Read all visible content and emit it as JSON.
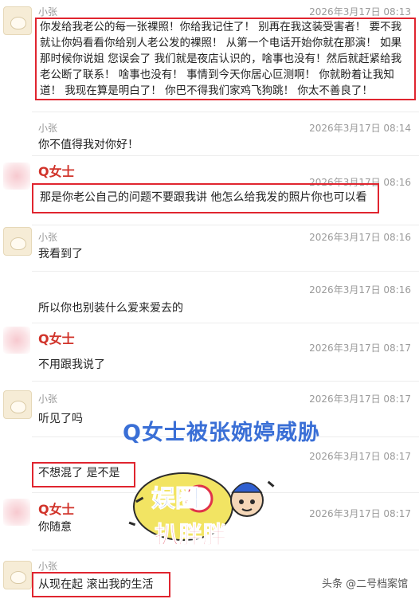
{
  "messages": [
    {
      "sender": "小张",
      "time": "2026年3月17日 08:13",
      "text": "你发给我老公的每一张裸照！你给我记住了！ 别再在我这装受害者！ 要不我就让你妈看看你给别人老公发的裸照！ 从第一个电话开始你就在那演！ 如果那时候你说姐 您误会了 我们就是夜店认识的，啥事也没有！然后就赶紧给我老公断了联系！ 啥事也没有！ 事情到今天你居心叵测啊！ 你就盼着让我知道！ 我现在算是明白了！ 你巴不得我们家鸡飞狗跳！ 你太不善良了！"
    },
    {
      "sender": "小张",
      "time": "2026年3月17日 08:14",
      "text": "你不值得我对你好！"
    },
    {
      "sender": "Q女士",
      "time": "2026年3月17日 08:16",
      "text": "那是你老公自己的问题不要跟我讲 他怎么给我发的照片你也可以看"
    },
    {
      "sender": "小张",
      "time": "2026年3月17日 08:16",
      "text": "我看到了"
    },
    {
      "sender": "",
      "time": "2026年3月17日 08:16",
      "text": "所以你也别装什么爱来爱去的"
    },
    {
      "sender": "Q女士",
      "time": "2026年3月17日 08:17",
      "text": "不用跟我说了"
    },
    {
      "sender": "小张",
      "time": "2026年3月17日 08:17",
      "text": "听见了吗"
    },
    {
      "sender": "",
      "time": "2026年3月17日 08:17",
      "text": "不想混了 是不是"
    },
    {
      "sender": "Q女士",
      "time": "2026年3月17日 08:17",
      "text": "你随意"
    },
    {
      "sender": "小张",
      "time": "2026年3月17日 08:17",
      "text": "从现在起 滚出我的生活"
    }
  ],
  "overlay": {
    "caption": "Q女士被张婉婷威胁",
    "logo_top": "娱圈",
    "logo_bottom": "扒胖胖",
    "footer": "头条 @二号档案馆"
  }
}
